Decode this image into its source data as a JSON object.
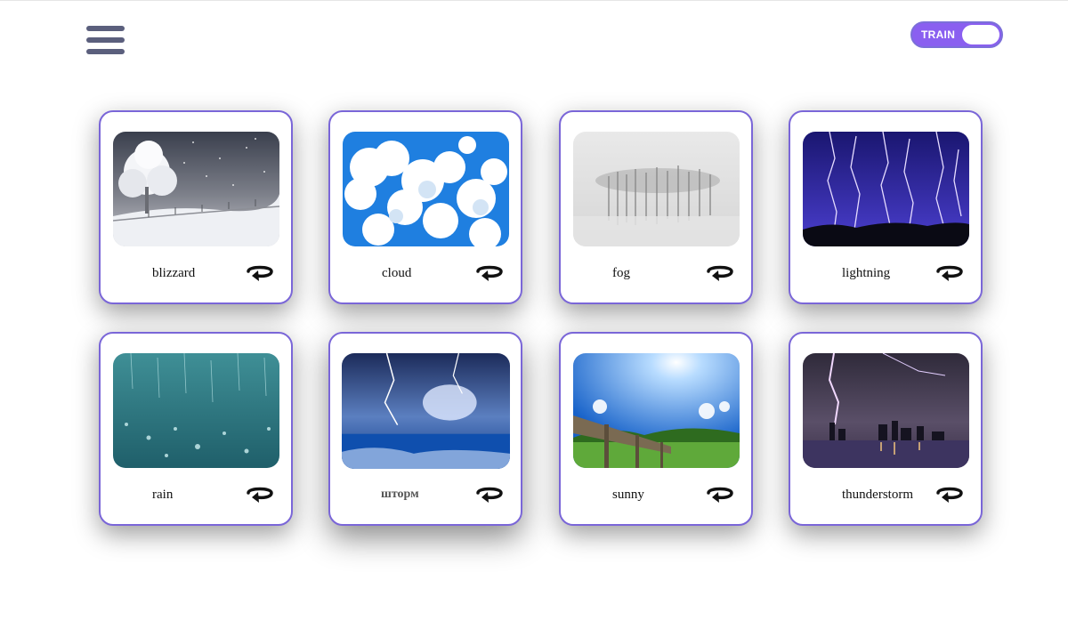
{
  "header": {
    "menu_icon": "hamburger-menu-icon",
    "mode_toggle": {
      "label": "TRAIN",
      "accent": "#8a5ff0"
    }
  },
  "cards": [
    {
      "word": "blizzard",
      "image": "snowy-tree-landscape",
      "flip_icon": "rotate-arrow-icon"
    },
    {
      "word": "cloud",
      "image": "white-clouds-blue-sky",
      "flip_icon": "rotate-arrow-icon"
    },
    {
      "word": "fog",
      "image": "misty-forest",
      "flip_icon": "rotate-arrow-icon"
    },
    {
      "word": "lightning",
      "image": "lightning-bolts-night",
      "flip_icon": "rotate-arrow-icon"
    },
    {
      "word": "rain",
      "image": "raindrops-on-surface",
      "flip_icon": "rotate-arrow-icon"
    },
    {
      "word": "шторм",
      "image": "storm-over-sea",
      "flip_icon": "rotate-arrow-icon"
    },
    {
      "word": "sunny",
      "image": "sun-over-fence-field",
      "flip_icon": "rotate-arrow-icon"
    },
    {
      "word": "thunderstorm",
      "image": "lightning-over-city-skyline",
      "flip_icon": "rotate-arrow-icon"
    }
  ],
  "colors": {
    "card_border": "#7a66d8",
    "menu_bars": "#5b5f7d"
  }
}
